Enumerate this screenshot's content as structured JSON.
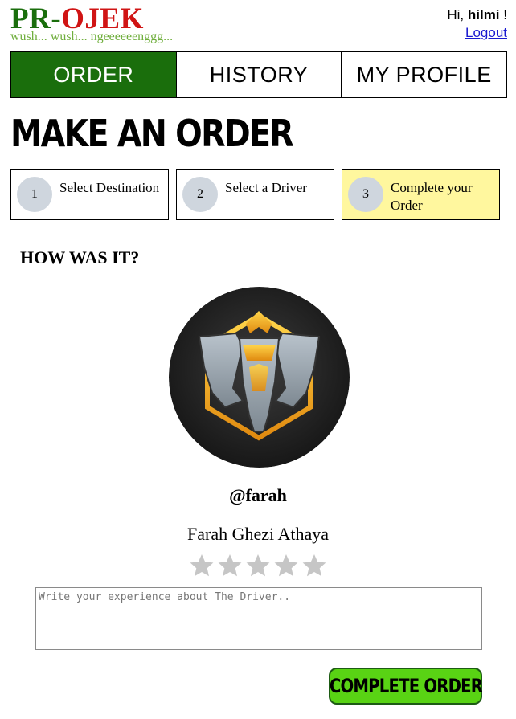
{
  "brand": {
    "logo_part1": "PR-",
    "logo_part2": "OJEK",
    "tagline": "wush... wush... ngeeeeeenggg...",
    "colors": {
      "primary_green": "#1a6e0c",
      "logo_red": "#d01414",
      "tagline_green": "#6fae3c",
      "action_green": "#59d314",
      "highlight_yellow": "#fff79e"
    }
  },
  "user": {
    "greeting": "Hi,",
    "name": "hilmi",
    "suffix": "!",
    "logout_label": "Logout"
  },
  "nav": {
    "tabs": [
      {
        "label": "ORDER",
        "active": true
      },
      {
        "label": "HISTORY",
        "active": false
      },
      {
        "label": "MY PROFILE",
        "active": false
      }
    ]
  },
  "page": {
    "title": "MAKE AN ORDER"
  },
  "steps": [
    {
      "number": "1",
      "label": "Select Destination",
      "current": false
    },
    {
      "number": "2",
      "label": "Select a Driver",
      "current": false
    },
    {
      "number": "3",
      "label": "Complete your Order",
      "current": true
    }
  ],
  "rating": {
    "heading": "HOW WAS IT?",
    "driver_username": "@farah",
    "driver_name": "Farah Ghezi Athaya",
    "avatar_icon": "elephant-logo-icon",
    "stars_total": 5,
    "stars_selected": 0,
    "feedback_placeholder": "Write your experience about The Driver..",
    "feedback_value": "",
    "submit_label": "COMPLETE ORDER"
  }
}
